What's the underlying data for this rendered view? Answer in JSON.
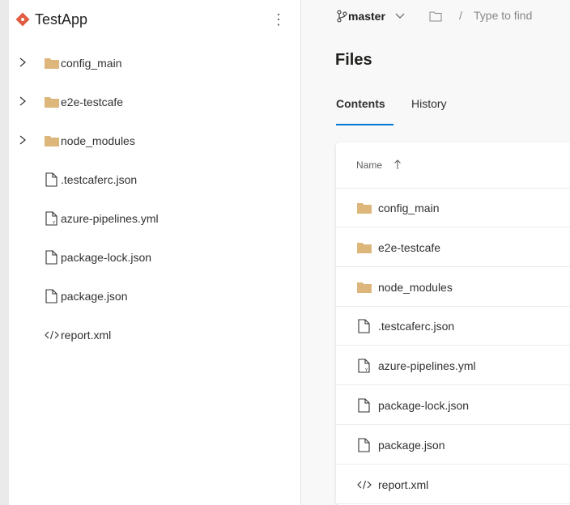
{
  "sidebar": {
    "app_name": "TestApp",
    "more_label": "⋮",
    "items": [
      {
        "label": "config_main",
        "kind": "folder",
        "icon": "folder-icon",
        "expandable": true
      },
      {
        "label": "e2e-testcafe",
        "kind": "folder",
        "icon": "folder-icon",
        "expandable": true
      },
      {
        "label": "node_modules",
        "kind": "folder",
        "icon": "folder-icon",
        "expandable": true
      },
      {
        "label": ".testcaferc.json",
        "kind": "file",
        "icon": "file-icon",
        "expandable": false
      },
      {
        "label": "azure-pipelines.yml",
        "kind": "yaml",
        "icon": "yaml-file-icon",
        "expandable": false
      },
      {
        "label": "package-lock.json",
        "kind": "file",
        "icon": "file-icon",
        "expandable": false
      },
      {
        "label": "package.json",
        "kind": "file",
        "icon": "file-icon",
        "expandable": false
      },
      {
        "label": "report.xml",
        "kind": "code",
        "icon": "code-file-icon",
        "expandable": false
      }
    ]
  },
  "toolbar": {
    "branch": "master",
    "path_separator": "/",
    "path_placeholder": "Type to find"
  },
  "main": {
    "title": "Files",
    "tabs": [
      {
        "label": "Contents",
        "active": true
      },
      {
        "label": "History",
        "active": false
      }
    ],
    "table": {
      "column_name": "Name",
      "sort": "ascending",
      "rows": [
        {
          "label": "config_main",
          "kind": "folder",
          "icon": "folder-icon"
        },
        {
          "label": "e2e-testcafe",
          "kind": "folder",
          "icon": "folder-icon"
        },
        {
          "label": "node_modules",
          "kind": "folder",
          "icon": "folder-icon"
        },
        {
          "label": ".testcaferc.json",
          "kind": "file",
          "icon": "file-icon"
        },
        {
          "label": "azure-pipelines.yml",
          "kind": "yaml",
          "icon": "yaml-file-icon"
        },
        {
          "label": "package-lock.json",
          "kind": "file",
          "icon": "file-icon"
        },
        {
          "label": "package.json",
          "kind": "file",
          "icon": "file-icon"
        },
        {
          "label": "report.xml",
          "kind": "code",
          "icon": "code-file-icon"
        }
      ]
    }
  },
  "colors": {
    "accent": "#0078d4",
    "folder": "#dcb67a",
    "logo": "#e05d44"
  }
}
